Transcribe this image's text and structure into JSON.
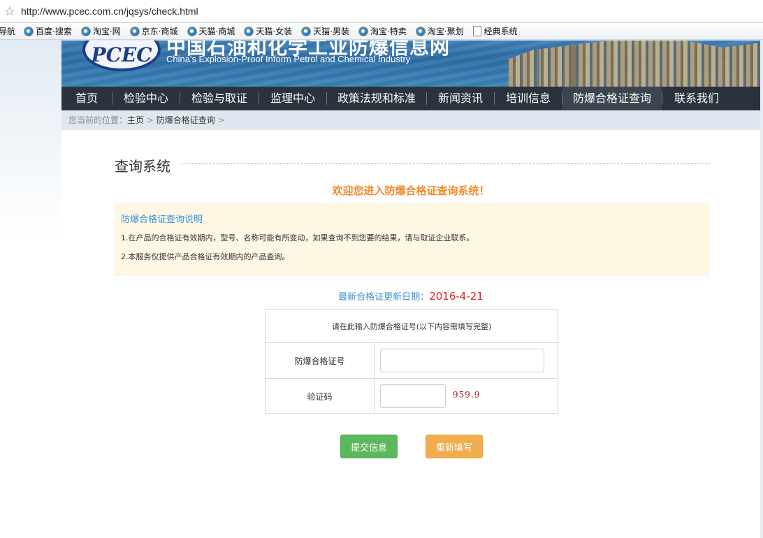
{
  "browser": {
    "url": "http://www.pcec.com.cn/jqsys/check.html",
    "favorites": [
      {
        "label": "导航",
        "icon": "none"
      },
      {
        "label": "百度·搜索",
        "icon": "ie-icon"
      },
      {
        "label": "淘宝·网",
        "icon": "ie-icon"
      },
      {
        "label": "京东·商城",
        "icon": "ie-icon"
      },
      {
        "label": "天猫·商城",
        "icon": "ie-icon"
      },
      {
        "label": "天猫·女装",
        "icon": "ie-icon"
      },
      {
        "label": "天猫·男装",
        "icon": "ie-icon"
      },
      {
        "label": "淘宝·特卖",
        "icon": "ie-icon"
      },
      {
        "label": "淘宝·聚划",
        "icon": "ie-icon"
      },
      {
        "label": "经典系统",
        "icon": "document-icon"
      }
    ]
  },
  "header": {
    "logo": "PCEC",
    "site_name_cn": "中国石油和化学工业防爆信息网",
    "site_name_en": "China's Explosion-Proof Inform  Petrol and Chemical Industry"
  },
  "nav": {
    "items": [
      "首页",
      "检验中心",
      "检验与取证",
      "监理中心",
      "政策法规和标准",
      "新闻资讯",
      "培训信息",
      "防爆合格证查询",
      "联系我们"
    ],
    "active_index": 7
  },
  "breadcrumb": {
    "prefix": "您当前的位置：",
    "home": "主页",
    "sep": ">",
    "current": "防爆合格证查询",
    "trail": ">"
  },
  "main": {
    "section_title": "查询系统",
    "welcome": "欢迎您进入防爆合格证查询系统！",
    "notice": {
      "title": "防爆合格证查询说明",
      "line1": "1.在产品的合格证有效期内，型号、名称可能有所变动，如果查询不到您要的结果，请与取证企业联系。",
      "line2": "2.本服务仅提供产品合格证有效期内的产品查询。"
    },
    "update": {
      "label": "最新合格证更新日期：",
      "date": "2016-4-21"
    },
    "form": {
      "header": "请在此输入防爆合格证号(以下内容需填写完整)",
      "cert_label": "防爆合格证号",
      "cert_value": "",
      "code_label": "验证码",
      "code_value": "",
      "captcha": "959.9"
    },
    "buttons": {
      "submit": "提交信息",
      "reset": "重新填写"
    }
  },
  "colors": {
    "nav_bg": "#2a333d",
    "welcome": "#f28a2e",
    "notice_bg": "#fdf7e4",
    "link_blue": "#3a8ed8",
    "date_red": "#e21f1f",
    "submit_green": "#5cb85c",
    "reset_orange": "#f0ad4e"
  }
}
